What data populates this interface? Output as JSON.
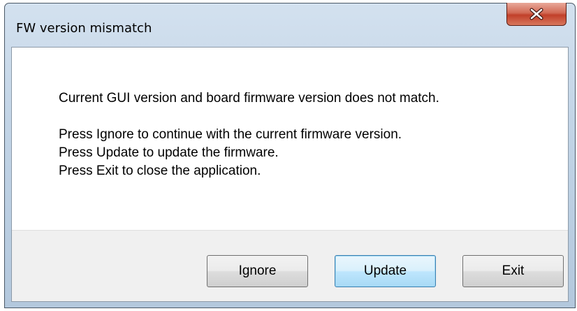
{
  "window": {
    "title": "FW version mismatch",
    "close_icon": "close-x-icon"
  },
  "message": {
    "line1": "Current GUI version and board firmware version does not match.",
    "line2": "Press Ignore to continue with the current firmware version.",
    "line3": "Press Update to update the firmware.",
    "line4": "Press Exit to close the application."
  },
  "buttons": {
    "ignore": "Ignore",
    "update": "Update",
    "exit": "Exit"
  },
  "colors": {
    "titlebar": "#c2d4e6",
    "close_button": "#c1402a",
    "default_button_border": "#3c7fb1"
  }
}
